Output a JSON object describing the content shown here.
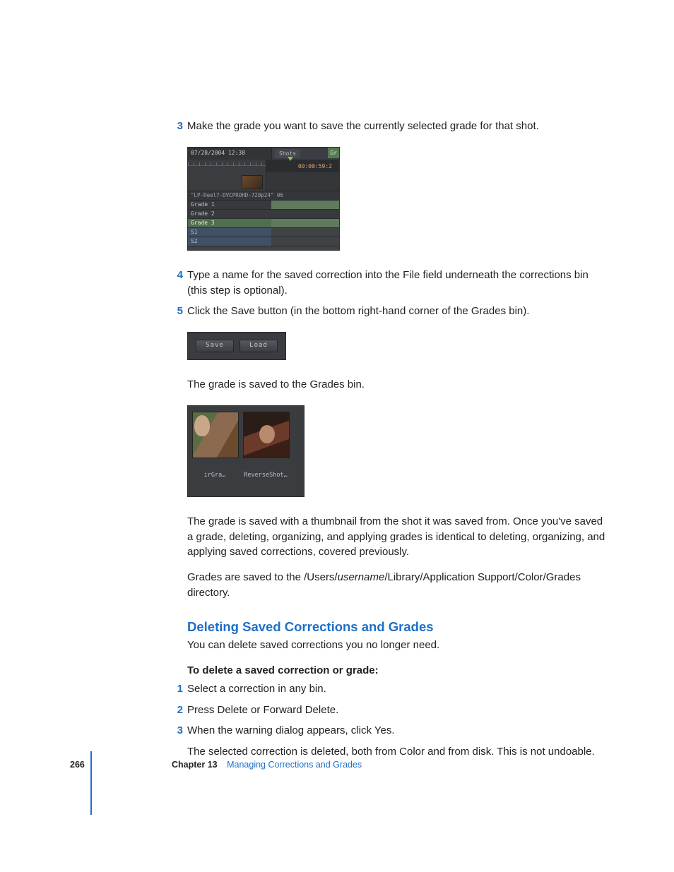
{
  "steps_a": {
    "s3": {
      "num": "3",
      "text": "Make the grade you want to save the currently selected grade for that shot."
    },
    "s4": {
      "num": "4",
      "text": "Type a name for the saved correction into the File field underneath the corrections bin (this step is optional)."
    },
    "s5": {
      "num": "5",
      "text": "Click the Save button (in the bottom right-hand corner of the Grades bin)."
    }
  },
  "fig1": {
    "timestamp": "07/28/2004 12:38",
    "tab_shots": "Shots",
    "tab_gr": "Gr",
    "timecode": "00:00:59:2",
    "clipname": "\"LP-Reel7-DVCPROHD-720p24\" 06",
    "rows": {
      "g1": "Grade 1",
      "g2": "Grade 2",
      "g3": "Grade 3",
      "s1": "S1",
      "s2": "S2"
    }
  },
  "fig2": {
    "save": "Save",
    "load": "Load"
  },
  "fig3": {
    "a": "irGra…",
    "b": "ReverseShot…"
  },
  "para_after_fig2": "The grade is saved to the Grades bin.",
  "para_after_fig3": "The grade is saved with a thumbnail from the shot it was saved from. Once you've saved a grade, deleting, organizing, and applying grades is identical to deleting, organizing, and applying saved corrections, covered previously.",
  "para_path_a": "Grades are saved to the /Users/",
  "para_path_i": "username",
  "para_path_b": "/Library/Application Support/Color/Grades directory.",
  "section_head": "Deleting Saved Corrections and Grades",
  "section_intro": "You can delete saved corrections you no longer need.",
  "procedure_head": "To delete a saved correction or grade:",
  "steps_b": {
    "s1": {
      "num": "1",
      "text": "Select a correction in any bin."
    },
    "s2": {
      "num": "2",
      "text": "Press Delete or Forward Delete."
    },
    "s3": {
      "num": "3",
      "text": "When the warning dialog appears, click Yes."
    }
  },
  "para_final": "The selected correction is deleted, both from Color and from disk. This is not undoable.",
  "footer": {
    "page": "266",
    "chapter_label": "Chapter 13",
    "chapter_title": "Managing Corrections and Grades"
  }
}
